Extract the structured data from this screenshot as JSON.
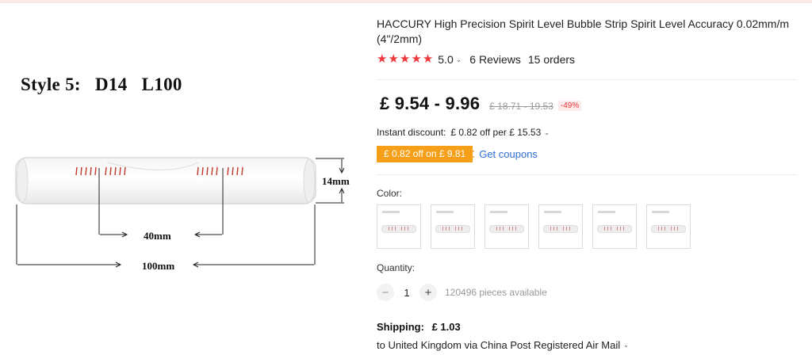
{
  "product": {
    "title": "HACCURY High Precision Spirit Level Bubble Strip Spirit Level Accuracy 0.02mm/m (4\"/2mm)",
    "rating": "5.0",
    "reviews": "6 Reviews",
    "orders": "15 orders",
    "star_count": 5
  },
  "image": {
    "caption": "Style 5:   D14   L100",
    "dim_height": "14mm",
    "dim_mark_spacing": "40mm",
    "dim_length": "100mm"
  },
  "price": {
    "current": "£ 9.54 - 9.96",
    "original": "£ 18.71 - 19.53",
    "discount": "-49%"
  },
  "instant_discount": {
    "label": "Instant discount:",
    "value": "£ 0.82 off per  £ 15.53"
  },
  "coupon": {
    "badge": "£ 0.82 off on  £ 9.81",
    "link": "Get coupons"
  },
  "color": {
    "label": "Color:",
    "options_count": 6
  },
  "quantity": {
    "label": "Quantity:",
    "value": "1",
    "available": "120496 pieces available"
  },
  "shipping": {
    "label": "Shipping:",
    "price": "£ 1.03",
    "destination": "to United Kingdom via China Post Registered Air Mail"
  },
  "colors": {
    "star": "#f0373c",
    "coupon_badge": "#f6a01a",
    "link": "#2e6fd8",
    "tube_marks": "#c0392b"
  },
  "icons": {
    "chevron": "chevron-down-icon",
    "minus": "minus-icon",
    "plus": "plus-icon",
    "star": "star-icon"
  }
}
